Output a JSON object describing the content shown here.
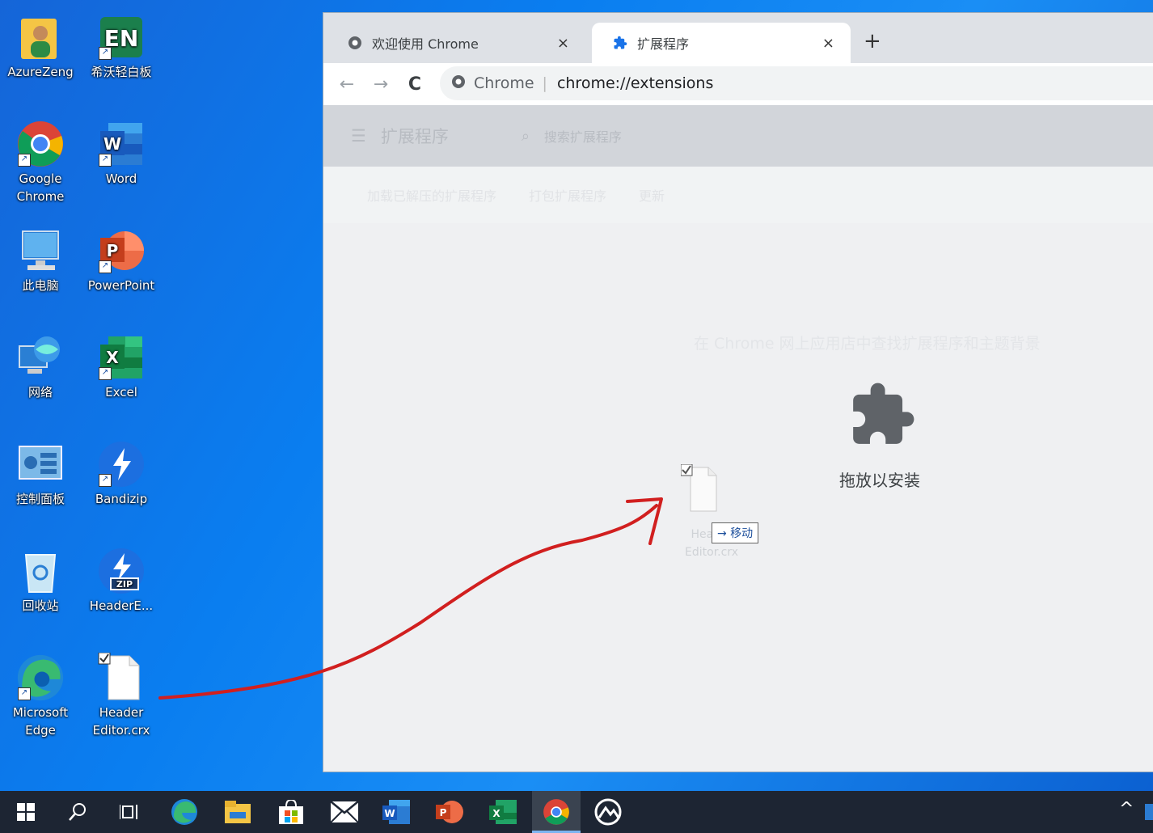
{
  "desktop": {
    "icons": [
      {
        "label": "AzureZeng"
      },
      {
        "label": "希沃轻白板"
      },
      {
        "label": "Google Chrome"
      },
      {
        "label": "Word"
      },
      {
        "label": "此电脑"
      },
      {
        "label": "PowerPoint"
      },
      {
        "label": "网络"
      },
      {
        "label": "Excel"
      },
      {
        "label": "控制面板"
      },
      {
        "label": "Bandizip"
      },
      {
        "label": "回收站"
      },
      {
        "label": "HeaderE..."
      },
      {
        "label": "Microsoft Edge"
      },
      {
        "label": "Header Editor.crx"
      }
    ],
    "zip_badge": "ZIP",
    "en_badge": "EN"
  },
  "browser": {
    "tabs": [
      {
        "label": "欢迎使用 Chrome",
        "close": "×"
      },
      {
        "label": "扩展程序",
        "close": "×"
      }
    ],
    "new_tab": "+",
    "nav": {
      "back": "←",
      "forward": "→",
      "reload": "C"
    },
    "address": {
      "site": "Chrome",
      "separator": "|",
      "url": "chrome://extensions"
    },
    "ext_page": {
      "menu_icon": "☰",
      "title": "扩展程序",
      "search_placeholder": "搜索扩展程序",
      "actions": [
        "加载已解压的扩展程序",
        "打包扩展程序",
        "更新"
      ],
      "store_hint": "在 Chrome 网上应用店中查找扩展程序和主题背景",
      "drop_label": "拖放以安装"
    },
    "drag_ghost": {
      "file_label": "Header Editor.crx",
      "tooltip": "→ 移动"
    }
  },
  "taskbar": {
    "items": [
      "start",
      "search",
      "task-view",
      "edge",
      "file-explorer",
      "store",
      "mail",
      "word",
      "powerpoint",
      "excel",
      "chrome",
      "app"
    ],
    "tray_arrow": "^"
  },
  "colors": {
    "chrome_tab_bar": "#dee1e6",
    "taskbar": "#1d2533",
    "arrow": "#d11f1f",
    "extension_icon": "#5f6368"
  }
}
